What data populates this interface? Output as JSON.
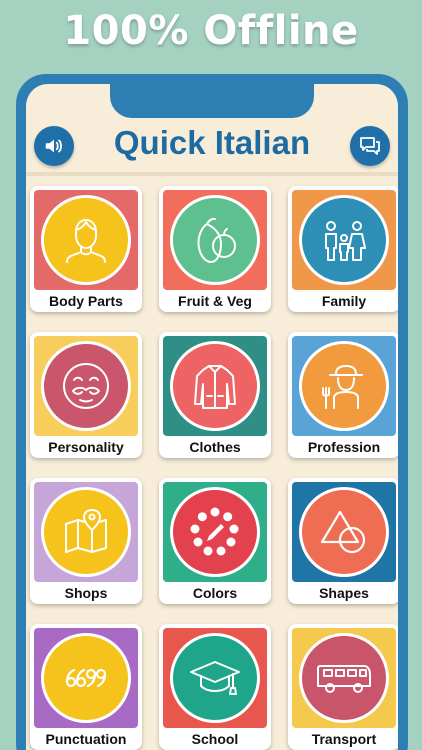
{
  "banner": {
    "text": "100% Offline"
  },
  "app": {
    "title": "Quick Italian",
    "sound_icon": "speaker-icon",
    "chat_icon": "chat-bubbles-icon"
  },
  "categories": [
    {
      "label": "Body Parts",
      "icon": "person-icon",
      "bg": "#e46a6a",
      "circle": "#f6c21c"
    },
    {
      "label": "Fruit & Veg",
      "icon": "fruit-icon",
      "bg": "#f26d5b",
      "circle": "#5ec08f"
    },
    {
      "label": "Family",
      "icon": "family-icon",
      "bg": "#f0984a",
      "circle": "#2e8fb6"
    },
    {
      "label": "Personality",
      "icon": "mustache-face-icon",
      "bg": "#f7cd5c",
      "circle": "#c9566a"
    },
    {
      "label": "Clothes",
      "icon": "jacket-icon",
      "bg": "#2f8f86",
      "circle": "#ee6363"
    },
    {
      "label": "Profession",
      "icon": "farmer-icon",
      "bg": "#5aa3d6",
      "circle": "#f19a3e"
    },
    {
      "label": "Shops",
      "icon": "map-pin-icon",
      "bg": "#c6a6d8",
      "circle": "#f6c21c"
    },
    {
      "label": "Colors",
      "icon": "palette-icon",
      "bg": "#2fae8a",
      "circle": "#e4414e"
    },
    {
      "label": "Shapes",
      "icon": "shapes-icon",
      "bg": "#1f75a6",
      "circle": "#ef6d52"
    },
    {
      "label": "Punctuation",
      "icon": "quotes-icon",
      "bg": "#a96ac6",
      "circle": "#f6c21c"
    },
    {
      "label": "School",
      "icon": "graduation-cap-icon",
      "bg": "#e8574e",
      "circle": "#1fa58a"
    },
    {
      "label": "Transport",
      "icon": "bus-icon",
      "bg": "#f5c84e",
      "circle": "#c9556b"
    }
  ]
}
